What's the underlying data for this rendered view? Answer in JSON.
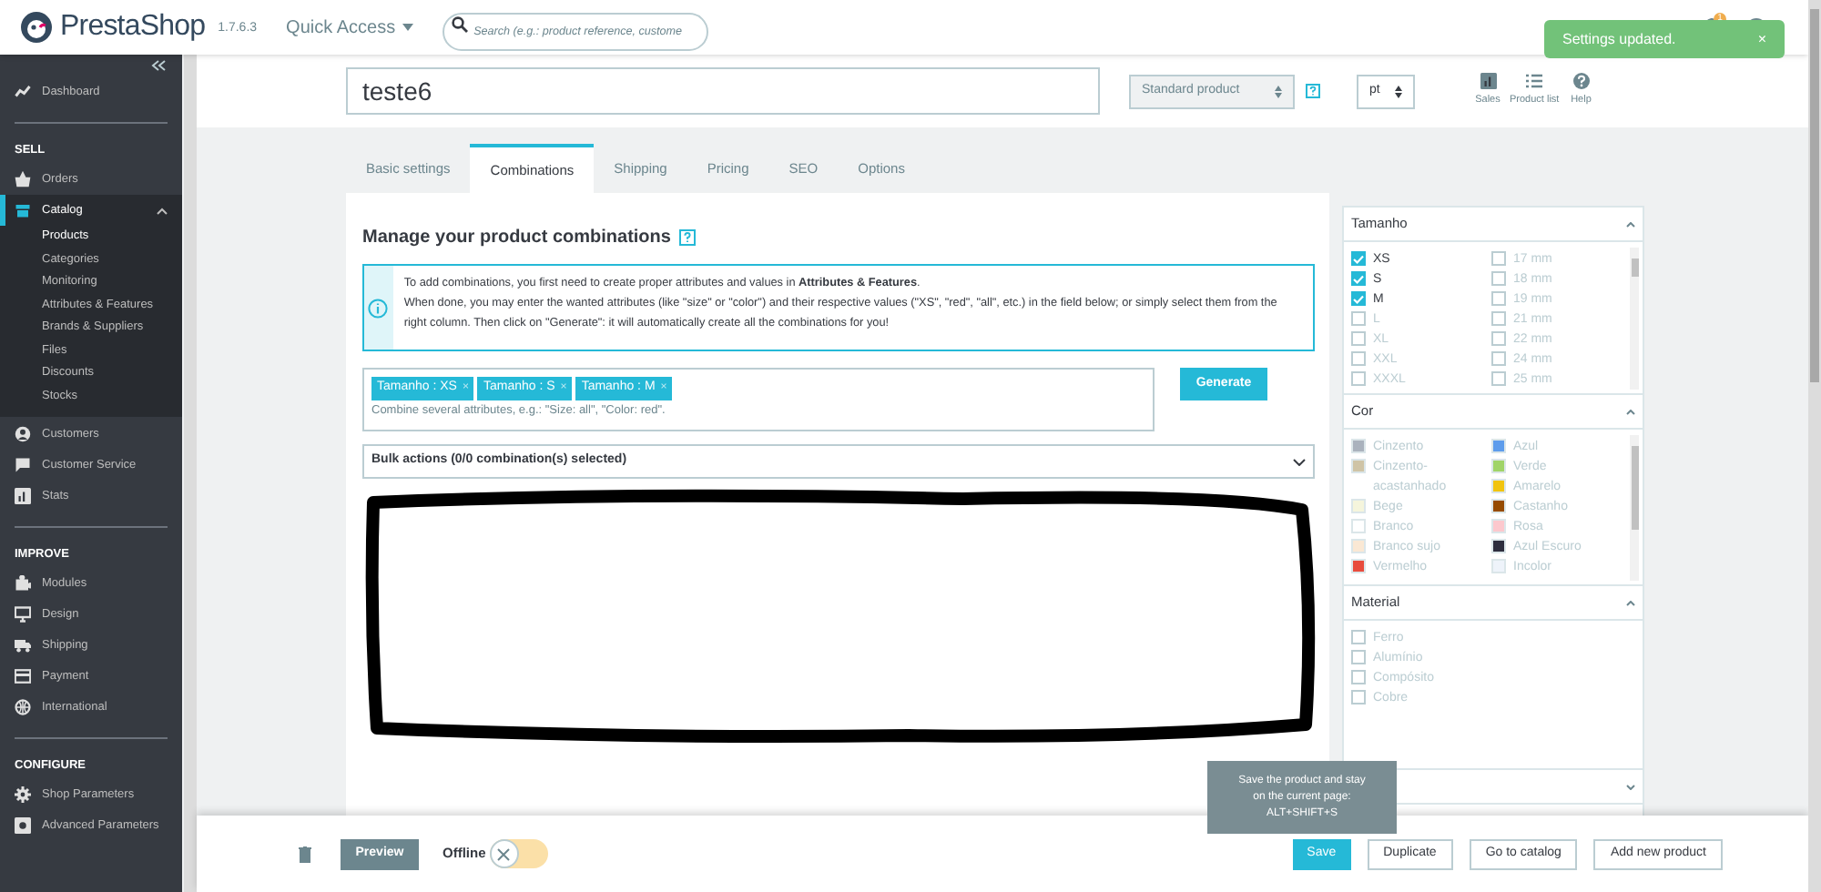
{
  "header": {
    "logo": "PrestaShop",
    "version": "1.7.6.3",
    "quick_access": "Quick Access",
    "search": {
      "placeholder": "Search (e.g.: product reference, custome"
    },
    "notifications": "1"
  },
  "toast": {
    "text": "Settings updated.",
    "close": "×"
  },
  "sidebar": {
    "sections": [
      {
        "items": [
          {
            "label": "Dashboard",
            "selected": false
          }
        ]
      },
      {
        "title": "SELL",
        "items": [
          {
            "label": "Orders",
            "selected": false
          },
          {
            "label": "Catalog",
            "selected": true,
            "expanded": true,
            "children": [
              {
                "label": "Products",
                "selected": true
              },
              {
                "label": "Categories",
                "selected": false
              },
              {
                "label": "Monitoring",
                "selected": false
              },
              {
                "label": "Attributes & Features",
                "selected": false
              },
              {
                "label": "Brands & Suppliers",
                "selected": false
              },
              {
                "label": "Files",
                "selected": false
              },
              {
                "label": "Discounts",
                "selected": false
              },
              {
                "label": "Stocks",
                "selected": false
              }
            ]
          },
          {
            "label": "Customers",
            "selected": false
          },
          {
            "label": "Customer Service",
            "selected": false
          },
          {
            "label": "Stats",
            "selected": false
          }
        ]
      },
      {
        "title": "IMPROVE",
        "items": [
          {
            "label": "Modules",
            "selected": false
          },
          {
            "label": "Design",
            "selected": false
          },
          {
            "label": "Shipping",
            "selected": false
          },
          {
            "label": "Payment",
            "selected": false
          },
          {
            "label": "International",
            "selected": false
          }
        ]
      },
      {
        "title": "CONFIGURE",
        "items": [
          {
            "label": "Shop Parameters",
            "selected": false
          },
          {
            "label": "Advanced Parameters",
            "selected": false
          }
        ]
      }
    ]
  },
  "product": {
    "name": "teste6",
    "type": "Standard product",
    "language": "pt",
    "tools": [
      {
        "label": "Sales"
      },
      {
        "label": "Product list"
      },
      {
        "label": "Help"
      }
    ]
  },
  "tabs": [
    {
      "label": "Basic settings",
      "selected": false
    },
    {
      "label": "Combinations",
      "selected": true
    },
    {
      "label": "Shipping",
      "selected": false
    },
    {
      "label": "Pricing",
      "selected": false
    },
    {
      "label": "SEO",
      "selected": false
    },
    {
      "label": "Options",
      "selected": false
    }
  ],
  "combinations": {
    "title": "Manage your product combinations",
    "info": [
      "To add combinations, you first need to create proper attributes and values in **Attributes & Features**.",
      "When done, you may enter the wanted attributes (like \"size\" or \"color\") and their respective values (\"XS\", \"red\", \"all\", etc.) in the field below; or simply select them from the right column. Then click on \"Generate\": it will automatically create all the combinations for you!"
    ],
    "tags": [
      "Tamanho : XS",
      "Tamanho : S",
      "Tamanho : M"
    ],
    "remove": "×",
    "hint": "Combine several attributes, e.g.: \"Size: all\", \"Color: red\".",
    "generate": "Generate",
    "bulk_actions": "Bulk actions (0/0 combination(s) selected)"
  },
  "attributes": [
    {
      "title": "Tamanho",
      "expanded": true,
      "kind": "checkbox",
      "columns": [
        [
          {
            "label": "XS",
            "checked": true
          },
          {
            "label": "S",
            "checked": true
          },
          {
            "label": "M",
            "checked": true
          },
          {
            "label": "L",
            "checked": false
          },
          {
            "label": "XL",
            "checked": false
          },
          {
            "label": "XXL",
            "checked": false
          },
          {
            "label": "XXXL",
            "checked": false
          }
        ],
        [
          {
            "label": "17 mm",
            "checked": false
          },
          {
            "label": "18 mm",
            "checked": false
          },
          {
            "label": "19 mm",
            "checked": false
          },
          {
            "label": "21 mm",
            "checked": false
          },
          {
            "label": "22 mm",
            "checked": false
          },
          {
            "label": "24 mm",
            "checked": false
          },
          {
            "label": "25 mm",
            "checked": false
          }
        ]
      ]
    },
    {
      "title": "Cor",
      "expanded": true,
      "kind": "color",
      "columns": [
        [
          {
            "label": "Cinzento",
            "color": "#aab2bd"
          },
          {
            "label": "Cinzento-acastanhado",
            "color": "#cfc4a6"
          },
          {
            "label": "Bege",
            "color": "#f5f5dc"
          },
          {
            "label": "Branco",
            "color": "#ffffff"
          },
          {
            "label": "Branco sujo",
            "color": "#fae8d4"
          },
          {
            "label": "Vermelho",
            "color": "#e84c3d"
          }
        ],
        [
          {
            "label": "Azul",
            "color": "#5d9cec"
          },
          {
            "label": "Verde",
            "color": "#a0d468"
          },
          {
            "label": "Amarelo",
            "color": "#f1c40f"
          },
          {
            "label": "Castanho",
            "color": "#964b00"
          },
          {
            "label": "Rosa",
            "color": "#fcc8cd"
          },
          {
            "label": "Azul Escuro",
            "color": "#2e2e3e"
          },
          {
            "label": "Incolor",
            "color": "#eef3fa"
          }
        ]
      ]
    },
    {
      "title": "Material",
      "expanded": true,
      "kind": "checkbox",
      "columns": [
        [
          {
            "label": "Ferro",
            "checked": false
          },
          {
            "label": "Alumínio",
            "checked": false
          },
          {
            "label": "Compósito",
            "checked": false
          },
          {
            "label": "Cobre",
            "checked": false
          }
        ]
      ]
    },
    {
      "expanded": false
    }
  ],
  "footer": {
    "preview": "Preview",
    "status_label": "Offline",
    "online": false,
    "buttons": [
      {
        "label": "Save",
        "kind": "primary"
      },
      {
        "label": "Duplicate",
        "kind": "outline"
      },
      {
        "label": "Go to catalog",
        "kind": "outline"
      },
      {
        "label": "Add new product",
        "kind": "outline"
      }
    ]
  },
  "tooltip": [
    "Save the product and stay",
    "on the current page:",
    "ALT+SHIFT+S"
  ]
}
